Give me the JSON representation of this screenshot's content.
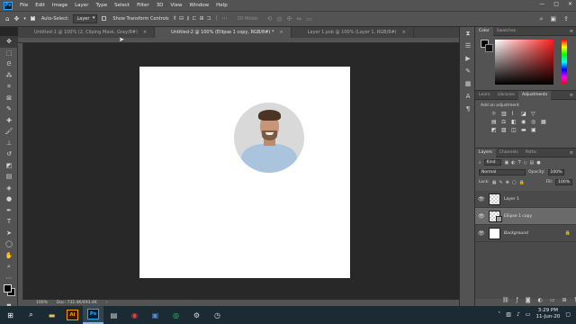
{
  "app": {
    "logo": "Ps",
    "menu": [
      "File",
      "Edit",
      "Image",
      "Layer",
      "Type",
      "Select",
      "Filter",
      "3D",
      "View",
      "Window",
      "Help"
    ],
    "window_controls": [
      "—",
      "□",
      "✕"
    ]
  },
  "options_bar": {
    "auto_select_label": "Auto-Select:",
    "auto_select_value": "Layer",
    "transform_label": "Show Transform Controls",
    "mode_3d_label": "3D Mode:"
  },
  "tabs": [
    {
      "label": "Untitled-1 @ 100% (2, Cliping Mask, Gray/8#)",
      "active": false
    },
    {
      "label": "Untitled-2 @ 100% (Ellipse 1 copy, RGB/8#) *",
      "active": true
    },
    {
      "label": "Layer 1.psb @ 100% (Layer 1, RGB/8#)",
      "active": false
    }
  ],
  "status": {
    "zoom": "100%",
    "doc": "Doc: 732.4K/493.4K",
    "arrow": "›"
  },
  "color_panel": {
    "tabs": [
      "Color",
      "Swatches"
    ]
  },
  "adjustments_panel": {
    "tabs": [
      "Learn",
      "Libraries",
      "Adjustments"
    ],
    "add_label": "Add an adjustment"
  },
  "layers_panel": {
    "tabs": [
      "Layers",
      "Channels",
      "Paths"
    ],
    "filter_kind": "Kind",
    "blend_mode": "Normal",
    "opacity_label": "Opacity:",
    "opacity_value": "100%",
    "lock_label": "Lock:",
    "fill_label": "Fill:",
    "fill_value": "100%",
    "layers": [
      {
        "name": "Layer 1",
        "selected": false,
        "thumb": "checker"
      },
      {
        "name": "Ellipse 1 copy",
        "selected": true,
        "thumb": "shape"
      },
      {
        "name": "Background",
        "selected": false,
        "thumb": "white",
        "locked": true
      }
    ]
  },
  "taskbar": {
    "time": "3:29 PM",
    "date": "11-Jun-20",
    "apps": [
      "Ai",
      "Ps"
    ]
  }
}
